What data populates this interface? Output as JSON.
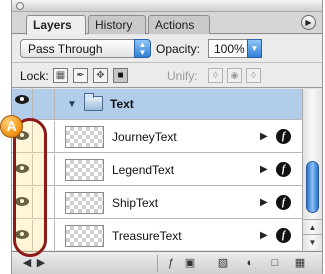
{
  "tabs": [
    {
      "label": "Layers",
      "active": true
    },
    {
      "label": "History",
      "active": false
    },
    {
      "label": "Actions",
      "active": false
    }
  ],
  "panel_menu_icon": "triangle-right-icon",
  "blend": {
    "mode": "Pass Through",
    "opacity_label": "Opacity:",
    "opacity_value": "100%"
  },
  "lock": {
    "label": "Lock:",
    "icons": [
      "lock-transparent-icon",
      "lock-image-icon",
      "lock-position-icon",
      "lock-all-icon"
    ],
    "unify_label": "Unify:",
    "unify_icons": [
      "unify-position-icon",
      "unify-visibility-icon",
      "unify-style-icon"
    ]
  },
  "group": {
    "name": "Text",
    "expanded": true
  },
  "layers": [
    {
      "name": "JourneyText"
    },
    {
      "name": "LegendText"
    },
    {
      "name": "ShipText"
    },
    {
      "name": "TreasureText"
    }
  ],
  "bottom_bar": {
    "icons": [
      "link-icon",
      "layer-style-icon",
      "mask-icon",
      "new-group-icon",
      "adjustment-icon",
      "new-layer-icon",
      "trash-icon"
    ]
  },
  "callout": {
    "label": "A"
  },
  "colors": {
    "selected_row": "#b2cde9",
    "accent": "#2f7fd6",
    "callout": "#f39a1c",
    "highlight_border": "#8d1a1a"
  }
}
